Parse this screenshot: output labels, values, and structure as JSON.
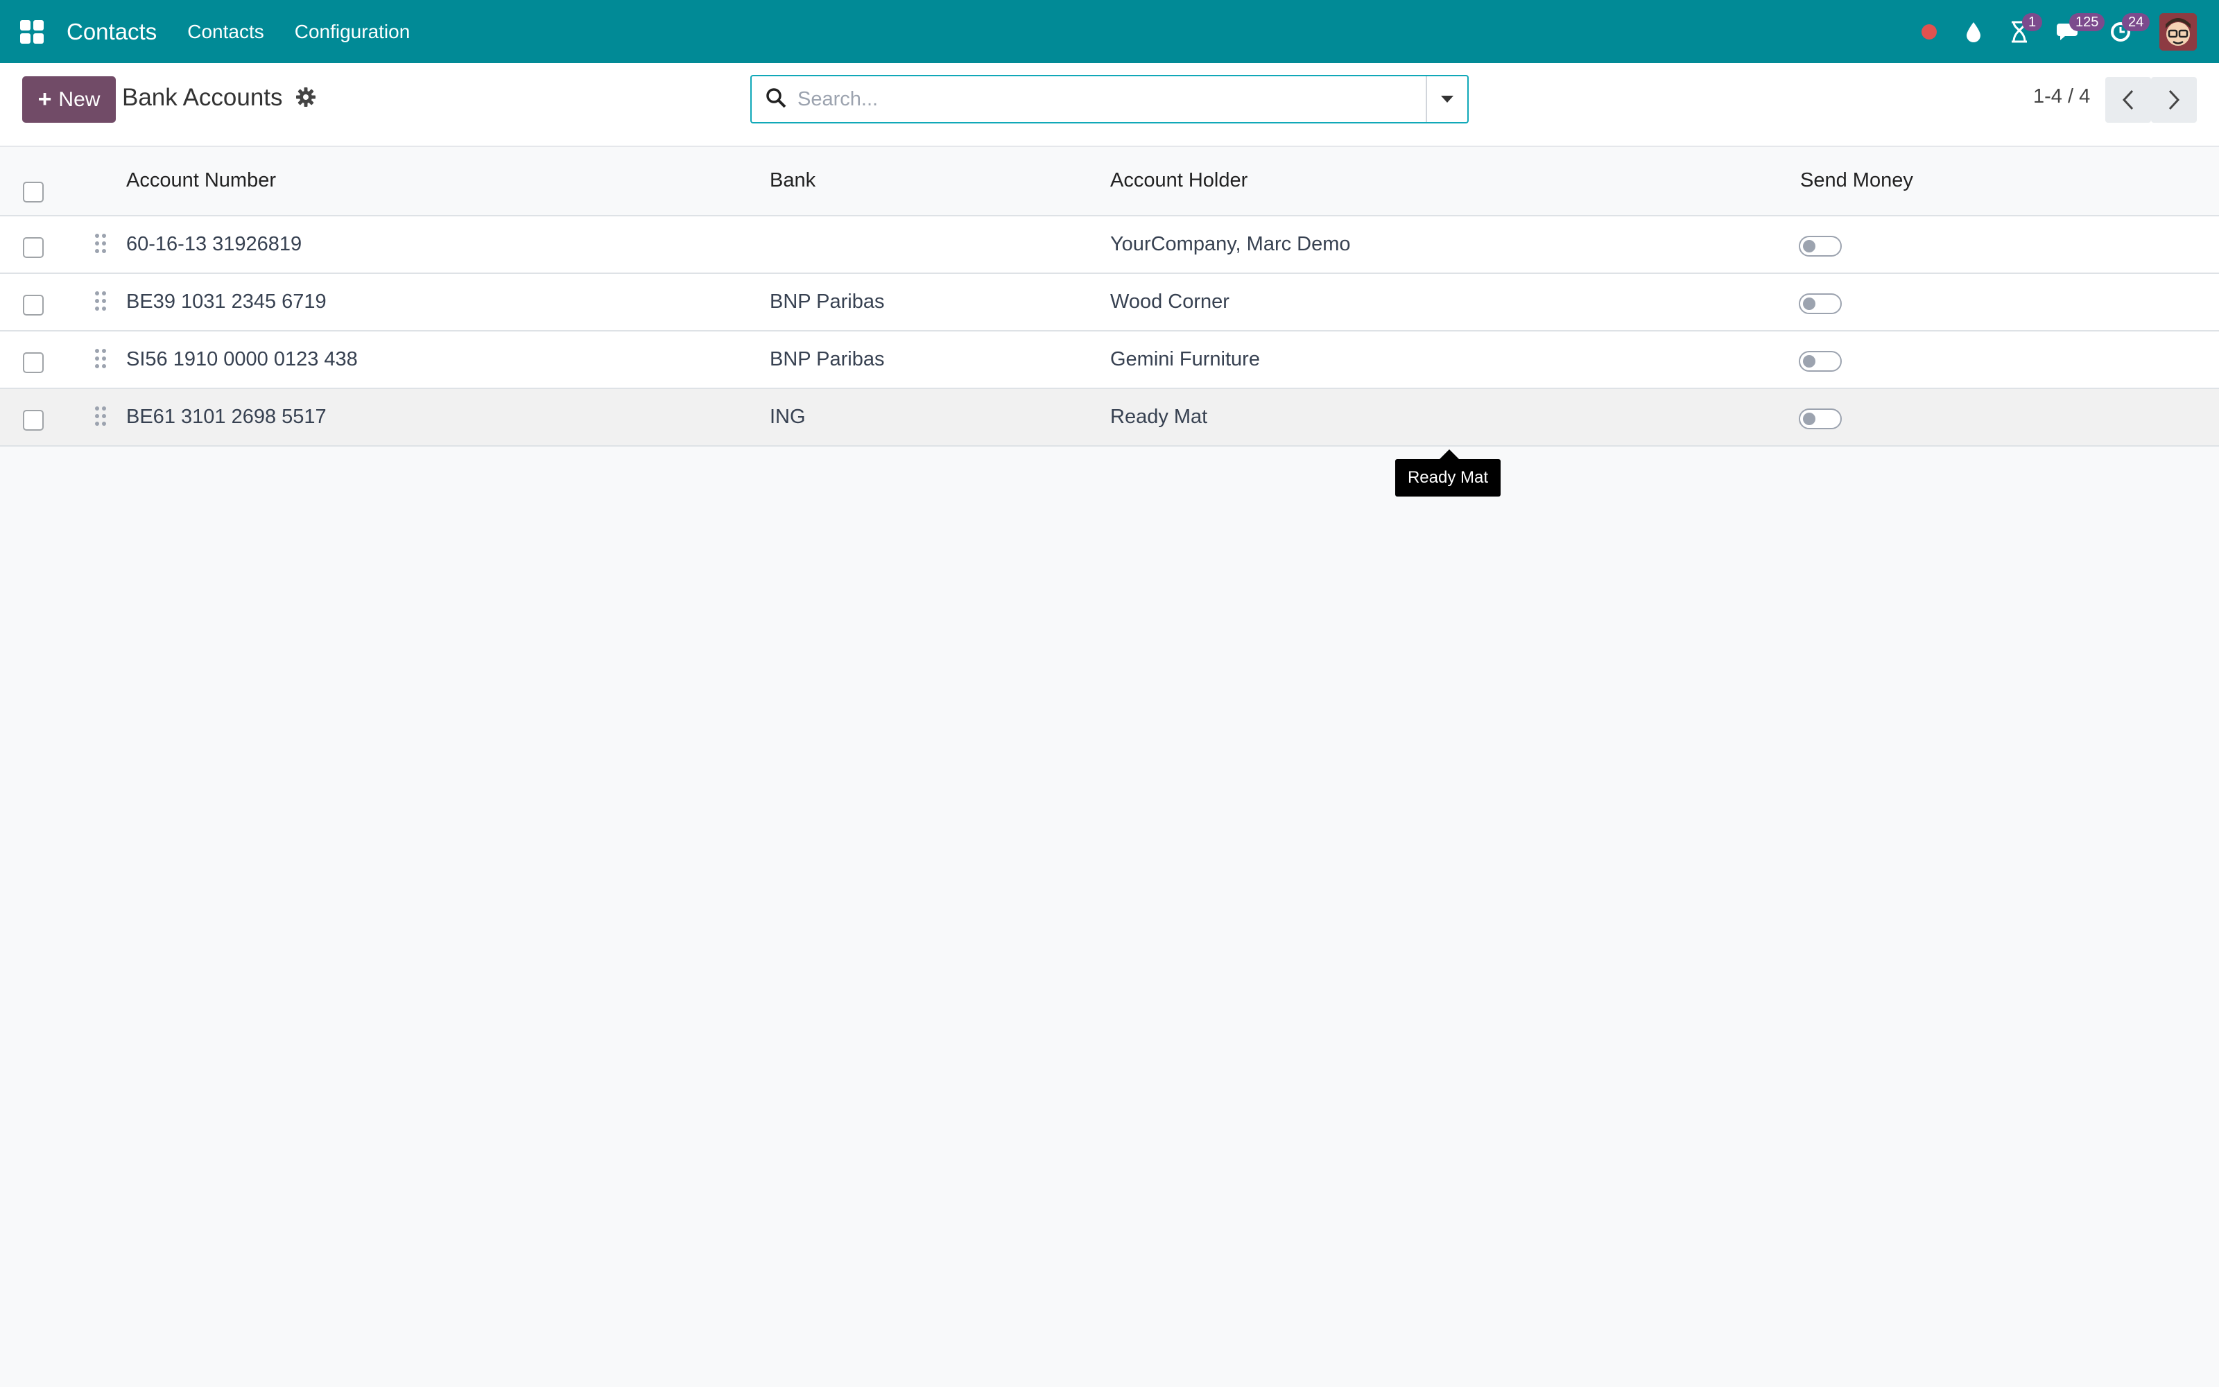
{
  "navbar": {
    "app_title": "Contacts",
    "menu": [
      "Contacts",
      "Configuration"
    ],
    "badges": {
      "activities": "1",
      "messages": "125",
      "updates": "24"
    },
    "color": "#018a96"
  },
  "control_panel": {
    "new_label": "New",
    "title": "Bank Accounts",
    "search_placeholder": "Search...",
    "pager": "1-4 / 4"
  },
  "table": {
    "headers": {
      "account_number": "Account Number",
      "bank": "Bank",
      "account_holder": "Account Holder",
      "send_money": "Send Money"
    },
    "rows": [
      {
        "account_number": "60-16-13 31926819",
        "bank": "",
        "account_holder": "YourCompany, Marc Demo",
        "send_money": false
      },
      {
        "account_number": "BE39 1031 2345 6719",
        "bank": "BNP Paribas",
        "account_holder": "Wood Corner",
        "send_money": false
      },
      {
        "account_number": "SI56 1910 0000 0123 438",
        "bank": "BNP Paribas",
        "account_holder": "Gemini Furniture",
        "send_money": false
      },
      {
        "account_number": "BE61 3101 2698 5517",
        "bank": "ING",
        "account_holder": "Ready Mat",
        "send_money": false
      }
    ]
  },
  "tooltip": {
    "text": "Ready Mat"
  },
  "colors": {
    "primary": "#714b67",
    "nav": "#018a96",
    "badge": "#7c4b8d"
  }
}
